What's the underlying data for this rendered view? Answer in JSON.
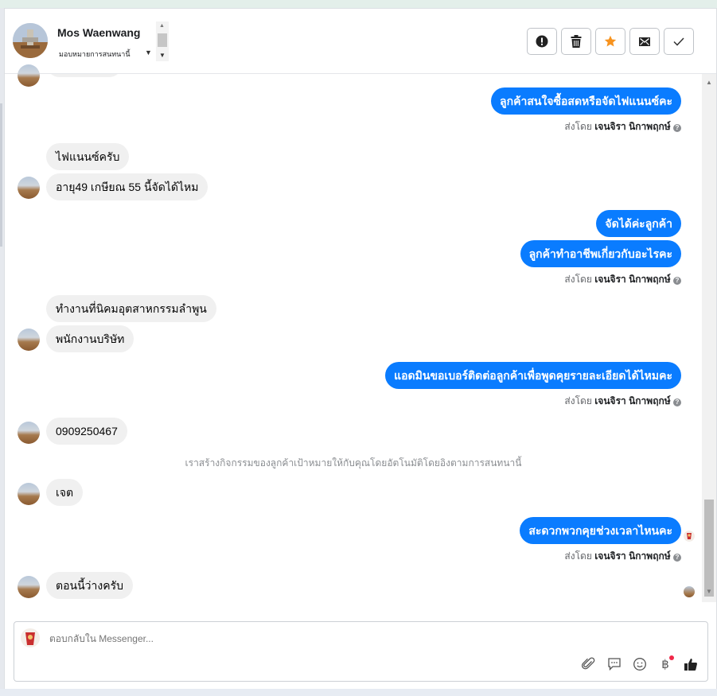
{
  "header": {
    "name": "Mos Waenwang",
    "assign_label": "มอบหมายการสนทนานี้"
  },
  "actions": [
    {
      "name": "report-button",
      "icon": "exclamation-circle-icon"
    },
    {
      "name": "delete-button",
      "icon": "trash-icon"
    },
    {
      "name": "star-button",
      "icon": "star-icon",
      "color": "#f7931e"
    },
    {
      "name": "mark-unread-button",
      "icon": "envelope-icon"
    },
    {
      "name": "done-button",
      "icon": "check-icon"
    }
  ],
  "messages": {
    "out1": "ลูกค้าสนใจซื้อสดหรือจัดไฟแนนซ์คะ",
    "in1": "ไฟแนนซ์ครับ",
    "in2": "อายุ49 เกษียณ 55 นี้จัดได้ไหม",
    "out2": "จัดได้ค่ะลูกค้า",
    "out3": "ลูกค้าทำอาชีพเกี่ยวกับอะไรคะ",
    "in3": "ทำงานที่นิคมอุตสาหกรรมลำพูน",
    "in4": "พนักงานบริษัท",
    "out4": "แอดมินขอเบอร์ติดต่อลูกค้าเพื่อพูดคุยรายละเอียดได้ไหมคะ",
    "in5": "0909250467",
    "notice": "เราสร้างกิจกรรมของลูกค้าเป้าหมายให้กับคุณโดยอัตโนมัติโดยอิงตามการสนทนานี้",
    "in6": "เจต",
    "out5": "สะดวกพวกคุยช่วงเวลาไหนคะ",
    "in7": "ตอนนี้ว่างครับ"
  },
  "sent_by": {
    "prefix": "ส่งโดย",
    "agent": "เจนจิรา นิกาพฤกษ์"
  },
  "composer": {
    "placeholder": "ตอบกลับใน Messenger..."
  },
  "colors": {
    "outgoing_bubble": "#0a7cff",
    "incoming_bubble": "#f0f0f0",
    "star": "#f7931e",
    "badge": "#f02849"
  }
}
